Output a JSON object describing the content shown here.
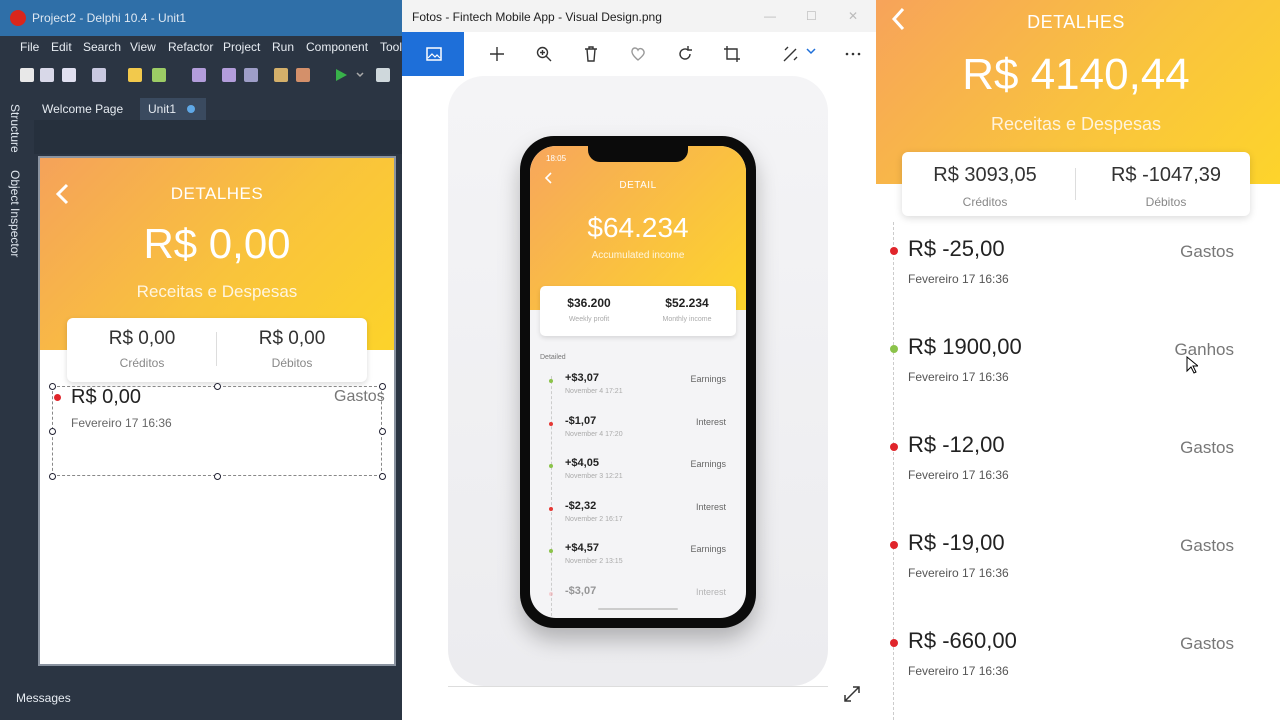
{
  "ide": {
    "window_title": "Project2 - Delphi 10.4 - Unit1",
    "menu": [
      "File",
      "Edit",
      "Search",
      "View",
      "Refactor",
      "Project",
      "Run",
      "Component",
      "Tool"
    ],
    "side_tabs": [
      "Structure",
      "Object Inspector"
    ],
    "tabs": [
      "Welcome Page",
      "Unit1"
    ],
    "messages_label": "Messages",
    "form": {
      "title": "DETALHES",
      "balance": "R$ 0,00",
      "subtitle": "Receitas e Despesas",
      "credits_value": "R$ 0,00",
      "credits_label": "Créditos",
      "debits_value": "R$ 0,00",
      "debits_label": "Débitos",
      "row": {
        "amount": "R$ 0,00",
        "type": "Gastos",
        "date": "Fevereiro 17 16:36"
      }
    }
  },
  "photos": {
    "window_title": "Fotos - Fintech Mobile App - Visual Design.png",
    "mockup": {
      "status_time": "18:05",
      "title": "DETAIL",
      "balance": "$64.234",
      "subtitle": "Accumulated income",
      "weekly_value": "$36.200",
      "weekly_label": "Weekly profit",
      "monthly_value": "$52.234",
      "monthly_label": "Monthly income",
      "section": "Detailed",
      "transactions": [
        {
          "amount": "+$3,07",
          "type": "Earnings",
          "date": "November 4 17:21",
          "color": "#8bc34a"
        },
        {
          "amount": "-$1,07",
          "type": "Interest",
          "date": "November 4 17:20",
          "color": "#e53935"
        },
        {
          "amount": "+$4,05",
          "type": "Earnings",
          "date": "November 3 12:21",
          "color": "#8bc34a"
        },
        {
          "amount": "-$2,32",
          "type": "Interest",
          "date": "November 2 16:17",
          "color": "#e53935"
        },
        {
          "amount": "+$4,57",
          "type": "Earnings",
          "date": "November 2 13:15",
          "color": "#8bc34a"
        },
        {
          "amount": "-$3,07",
          "type": "Interest",
          "date": "",
          "color": "#f3a0a4"
        }
      ]
    }
  },
  "app": {
    "title": "DETALHES",
    "balance": "R$ 4140,44",
    "subtitle": "Receitas e Despesas",
    "credits_value": "R$ 3093,05",
    "credits_label": "Créditos",
    "debits_value": "R$ -1047,39",
    "debits_label": "Débitos",
    "transactions": [
      {
        "amount": "R$ -25,00",
        "type": "Gastos",
        "date": "Fevereiro 17 16:36",
        "color": "#e0252b"
      },
      {
        "amount": "R$ 1900,00",
        "type": "Ganhos",
        "date": "Fevereiro 17 16:36",
        "color": "#8bc34a"
      },
      {
        "amount": "R$ -12,00",
        "type": "Gastos",
        "date": "Fevereiro 17 16:36",
        "color": "#e0252b"
      },
      {
        "amount": "R$ -19,00",
        "type": "Gastos",
        "date": "Fevereiro 17 16:36",
        "color": "#e0252b"
      },
      {
        "amount": "R$ -660,00",
        "type": "Gastos",
        "date": "Fevereiro 17 16:36",
        "color": "#e0252b"
      }
    ]
  }
}
